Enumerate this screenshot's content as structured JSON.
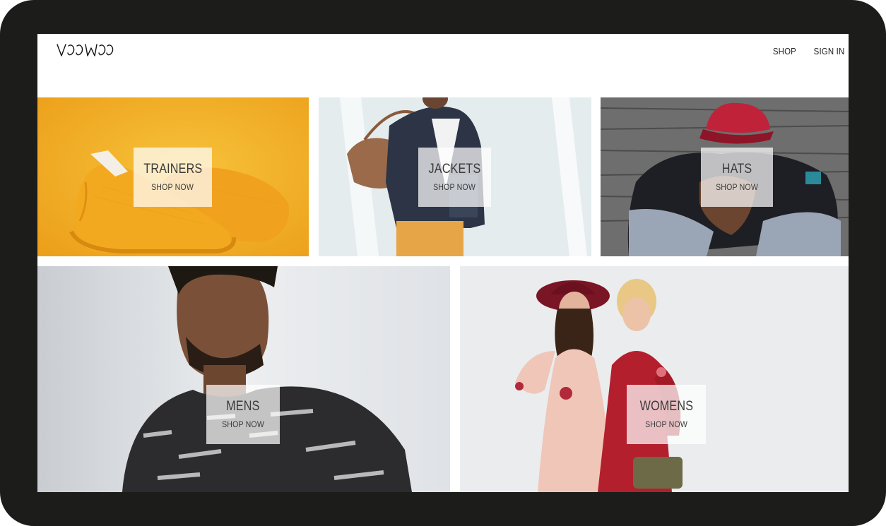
{
  "brand": {
    "logo_text": "VOOWOO"
  },
  "nav": {
    "items": [
      {
        "label": "SHOP"
      },
      {
        "label": "SIGN IN"
      }
    ]
  },
  "categories": [
    {
      "title": "TRAINERS",
      "cta": "SHOP NOW"
    },
    {
      "title": "JACKETS",
      "cta": "SHOP NOW"
    },
    {
      "title": "HATS",
      "cta": "SHOP NOW"
    },
    {
      "title": "MENS",
      "cta": "SHOP NOW"
    },
    {
      "title": "WOMENS",
      "cta": "SHOP NOW"
    }
  ],
  "colors": {
    "device_frame": "#1c1c1a",
    "trainers_bg": "#f3b62b",
    "label_overlay": "#ffffff"
  }
}
